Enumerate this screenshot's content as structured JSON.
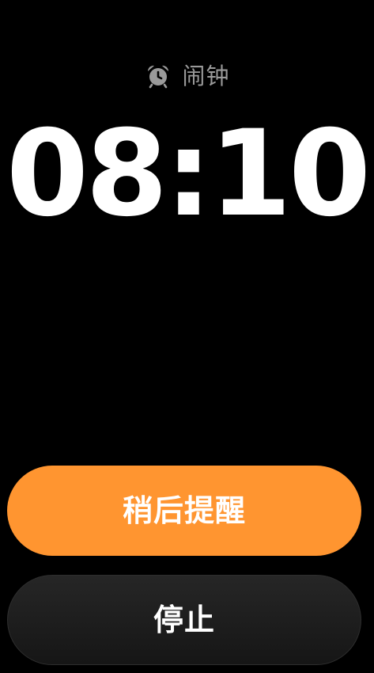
{
  "header": {
    "icon": "alarm-clock-icon",
    "title": "闹钟"
  },
  "alarm": {
    "time": "08:10"
  },
  "actions": {
    "snooze_label": "稍后提醒",
    "stop_label": "停止"
  },
  "colors": {
    "background": "#000000",
    "accent": "#ff9530",
    "stop_button": "#1f1f1f",
    "header_text": "#9a9a9a"
  }
}
